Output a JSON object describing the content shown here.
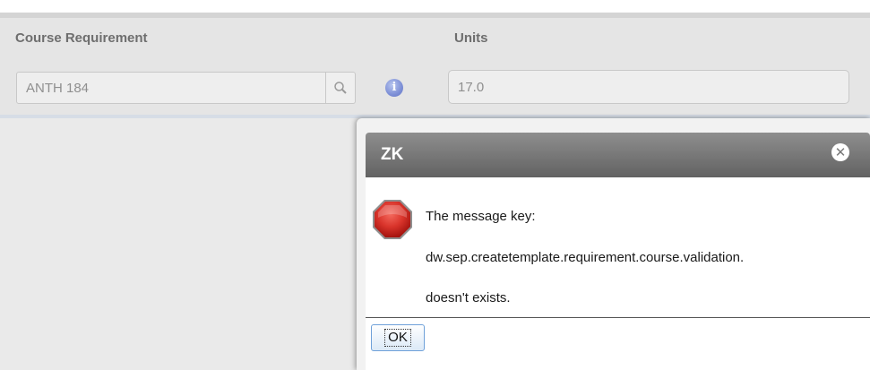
{
  "form": {
    "course_label": "Course Requirement",
    "units_label": "Units",
    "course_value": "ANTH 184",
    "units_value": "17.0"
  },
  "dialog": {
    "title": "ZK",
    "message_line1": "The message key:",
    "message_line2": "dw.sep.createtemplate.requirement.course.validation.",
    "message_line3": "doesn't exists.",
    "ok_label": "OK"
  },
  "icons": {
    "search": "search-icon",
    "info": "info-icon",
    "close": "close-icon",
    "error": "stop-sign-icon"
  },
  "colors": {
    "header_gradient_top": "#8e8e8e",
    "header_gradient_bottom": "#626262",
    "stop_red": "#d9342b",
    "info_blue": "#7d8fd6"
  }
}
